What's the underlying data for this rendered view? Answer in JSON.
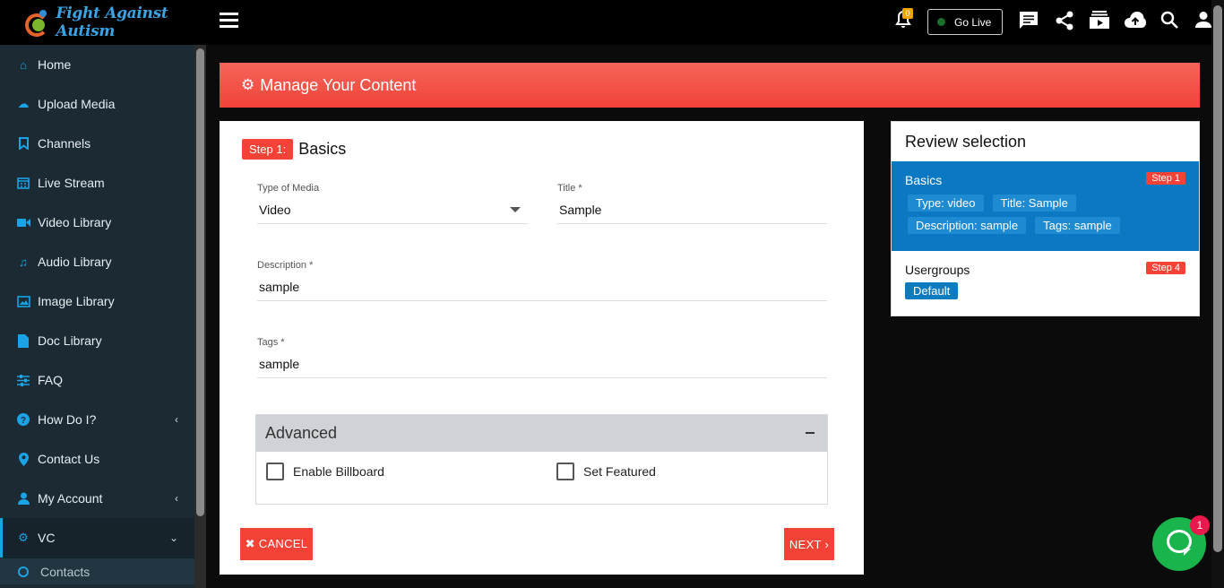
{
  "app": {
    "logo_text": "Fight Against Autism"
  },
  "sidebar": {
    "items": [
      {
        "label": "Home",
        "icon": "home-icon"
      },
      {
        "label": "Upload Media",
        "icon": "cloud-upload-icon"
      },
      {
        "label": "Channels",
        "icon": "bookmark-icon"
      },
      {
        "label": "Live Stream",
        "icon": "calendar-icon"
      },
      {
        "label": "Video Library",
        "icon": "video-camera-icon"
      },
      {
        "label": "Audio Library",
        "icon": "music-note-icon"
      },
      {
        "label": "Image Library",
        "icon": "image-icon"
      },
      {
        "label": "Doc Library",
        "icon": "document-icon"
      },
      {
        "label": "FAQ",
        "icon": "sliders-icon"
      },
      {
        "label": "How Do I?",
        "icon": "question-circle-icon",
        "chevron": "‹"
      },
      {
        "label": "Contact Us",
        "icon": "map-pin-icon"
      },
      {
        "label": "My Account",
        "icon": "user-icon",
        "chevron": "‹"
      },
      {
        "label": "VC",
        "icon": "cogs-icon",
        "chevron": "⌄"
      }
    ],
    "sub_item": "Contacts"
  },
  "topbar": {
    "notification_count": "0",
    "go_live_label": "Go Live"
  },
  "banner": {
    "title": "Manage Your Content"
  },
  "form": {
    "step_badge": "Step 1:",
    "step_name": "Basics",
    "type_label": "Type of Media",
    "type_value": "Video",
    "title_label": "Title *",
    "title_value": "Sample",
    "description_label": "Description *",
    "description_value": "sample",
    "tags_label": "Tags *",
    "tags_value": "sample",
    "advanced_label": "Advanced",
    "billboard_label": "Enable Billboard",
    "featured_label": "Set Featured",
    "cancel_label": "✖ CANCEL",
    "next_label": "NEXT ›"
  },
  "review": {
    "title": "Review selection",
    "basics": {
      "title": "Basics",
      "badge": "Step 1",
      "chips": [
        "Type: video",
        "Title: Sample",
        "Description: sample",
        "Tags: sample"
      ]
    },
    "usergroups": {
      "title": "Usergroups",
      "badge": "Step 4",
      "chips": [
        "Default"
      ]
    }
  },
  "chat": {
    "unread": "1"
  },
  "colors": {
    "accent_red": "#f44336",
    "primary_blue": "#0a78c2",
    "sidebar_bg": "#1c2b33",
    "chat_green": "#1ab44d"
  }
}
